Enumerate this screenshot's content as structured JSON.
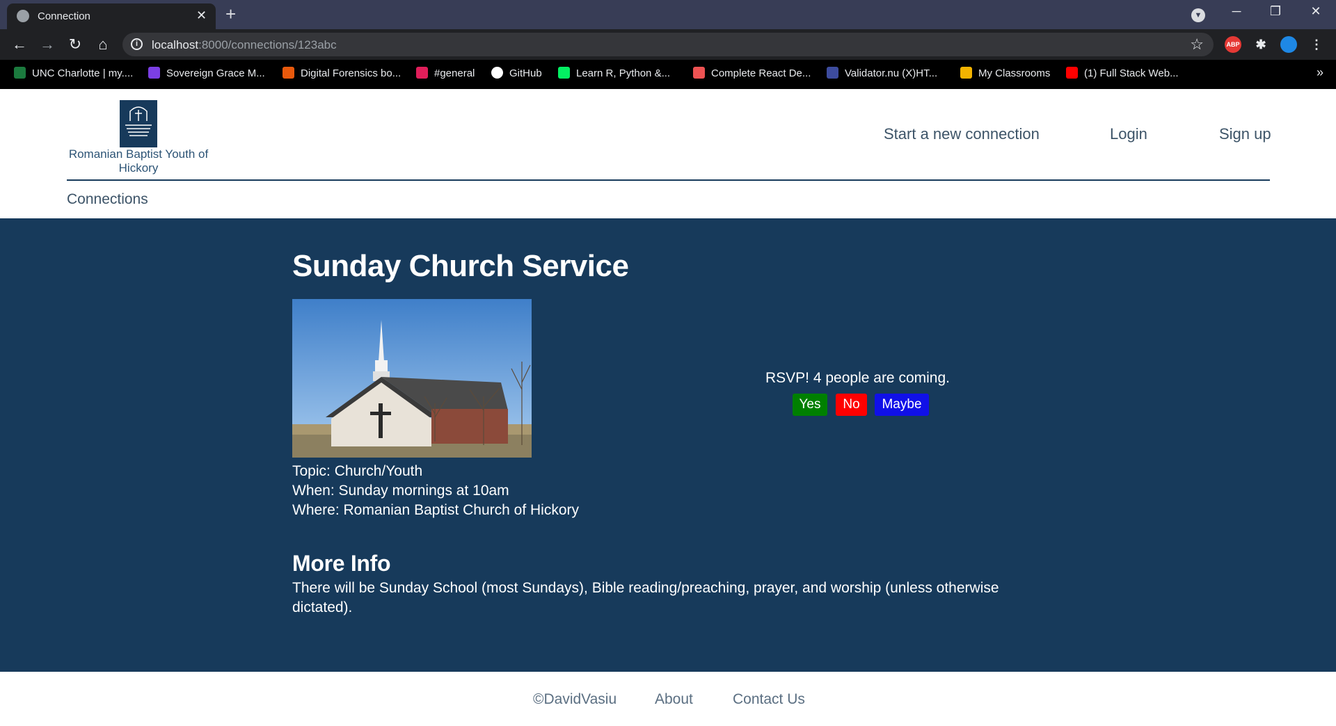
{
  "browser": {
    "tab_title": "Connection",
    "url_host": "localhost",
    "url_rest": ":8000/connections/123abc",
    "ext_abp": "ABP",
    "bookmarks": [
      {
        "label": "UNC Charlotte | my....",
        "color": "#1b7a3e"
      },
      {
        "label": "Sovereign Grace M...",
        "color": "#7b3fe4"
      },
      {
        "label": "Digital Forensics bo...",
        "color": "#e8590c"
      },
      {
        "label": "#general",
        "color": "#e01e5a"
      },
      {
        "label": "GitHub",
        "color": "#ffffff"
      },
      {
        "label": "Learn R, Python &...",
        "color": "#03ef62"
      },
      {
        "label": "Complete React De...",
        "color": "#ec5252"
      },
      {
        "label": "Validator.nu (X)HT...",
        "color": "#3d4c9e"
      },
      {
        "label": "My Classrooms",
        "color": "#f4b400"
      },
      {
        "label": "(1) Full Stack Web...",
        "color": "#ff0000"
      }
    ]
  },
  "header": {
    "logo_text": "Romanian Baptist Youth of Hickory",
    "nav": {
      "new_connection": "Start a new connection",
      "login": "Login",
      "signup": "Sign up"
    },
    "sub_link": "Connections"
  },
  "event": {
    "title": "Sunday Church Service",
    "topic": "Topic: Church/Youth",
    "when": "When: Sunday mornings at 10am",
    "where": "Where: Romanian Baptist Church of Hickory",
    "rsvp_text": "RSVP! 4 people are coming.",
    "rsvp_buttons": {
      "yes": "Yes",
      "no": "No",
      "maybe": "Maybe"
    },
    "more_title": "More Info",
    "more_text": "There will be Sunday School (most Sundays), Bible reading/preaching, prayer, and worship (unless otherwise dictated)."
  },
  "footer": {
    "copyright": "©DavidVasiu",
    "about": "About",
    "contact": "Contact Us"
  },
  "colors": {
    "main_bg": "#173a5b",
    "yes": "#008000",
    "no": "#ff0000",
    "maybe": "#0000ee"
  }
}
